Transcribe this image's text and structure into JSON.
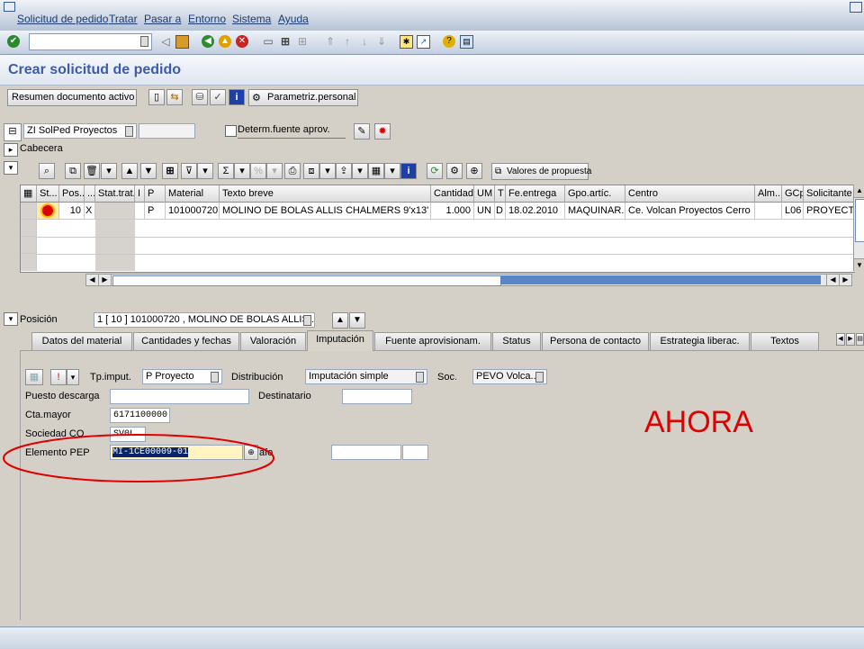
{
  "menu": {
    "items": [
      "Solicitud de pedido",
      "Tratar",
      "Pasar a",
      "Entorno",
      "Sistema",
      "Ayuda"
    ]
  },
  "toolbar": {
    "command_field_value": ""
  },
  "page": {
    "title": "Crear solicitud de pedido"
  },
  "app_toolbar": {
    "resumen_label": "Resumen documento activo",
    "parametriz_label": "Parametriz.personal"
  },
  "header": {
    "doc_type_value": "ZI SolPed Proyectos",
    "doc_number_value": "",
    "determ_label": "Determ.fuente aprov.",
    "cabecera_label": "Cabecera"
  },
  "grid_toolbar": {
    "valores_label": "Valores de propuesta"
  },
  "grid": {
    "columns": [
      "St...",
      "Pos...",
      "...",
      "Stat.trat.",
      "I",
      "P",
      "Material",
      "Texto breve",
      "Cantidad",
      "UM",
      "T",
      "Fe.entrega",
      "Gpo.artíc.",
      "Centro",
      "Alm...",
      "GCp",
      "Solicitante"
    ],
    "rows": [
      {
        "st": "",
        "pos": "10",
        "c3": "X",
        "stat": "",
        "i": "",
        "p": "P",
        "material": "101000720",
        "texto": "MOLINO DE BOLAS ALLIS CHALMERS 9'x13'",
        "cantidad": "1.000",
        "um": "UN",
        "t": "D",
        "fecha": "18.02.2010",
        "gpo": "MAQUINAR...",
        "centro": "Ce. Volcan Proyectos Cerro",
        "alm": "",
        "gcp": "L06",
        "solicitante": "PROYECTO"
      }
    ]
  },
  "position": {
    "label": "Posición",
    "value": "1 [ 10 ] 101000720 , MOLINO DE BOLAS ALLIS ..."
  },
  "tabs": [
    "Datos del material",
    "Cantidades y fechas",
    "Valoración",
    "Imputación",
    "Fuente aprovisionam.",
    "Status",
    "Persona de contacto",
    "Estrategia liberac.",
    "Textos"
  ],
  "active_tab": "Imputación",
  "imputacion": {
    "tp_imput_label": "Tp.imput.",
    "tp_imput_value": "P Proyecto",
    "distribucion_label": "Distribución",
    "distribucion_value": "Imputación simple",
    "soc_label": "Soc.",
    "soc_value": "PEVO Volca...",
    "puesto_label": "Puesto descarga",
    "puesto_value": "",
    "destinatario_label": "Destinatario",
    "destinatario_value": "",
    "cta_label": "Cta.mayor",
    "cta_value": "6171100000",
    "sociedad_label": "Sociedad CO",
    "sociedad_value": "SV0L",
    "pep_label": "Elemento PEP",
    "pep_value": "MI-1CE00009-01",
    "afo_label": "afo"
  },
  "annotation": {
    "text": "AHORA",
    "color": "#e00000"
  }
}
